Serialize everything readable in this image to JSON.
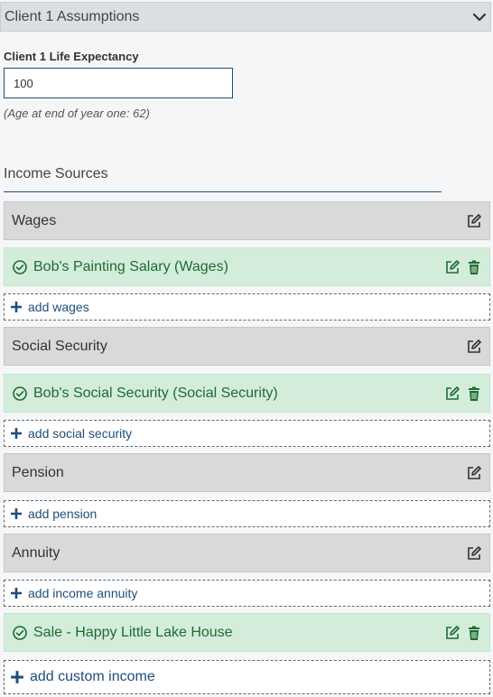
{
  "accordion": {
    "title": "Client 1 Assumptions"
  },
  "life_expectancy": {
    "label": "Client 1 Life Expectancy",
    "value": "100",
    "hint": "(Age at end of year one: 62)"
  },
  "income_sources": {
    "title": "Income Sources",
    "wages": {
      "label": "Wages",
      "items": [
        "Bob's Painting Salary (Wages)"
      ],
      "add_label": "add wages"
    },
    "social_security": {
      "label": "Social Security",
      "items": [
        "Bob's Social Security (Social Security)"
      ],
      "add_label": "add social security"
    },
    "pension": {
      "label": "Pension",
      "add_label": "add pension"
    },
    "annuity": {
      "label": "Annuity",
      "add_label": "add income annuity"
    },
    "custom": {
      "items": [
        "Sale - Happy Little Lake House"
      ],
      "add_label": "add custom income"
    }
  },
  "colors": {
    "accent": "#1f4e79",
    "item_bg": "#d4edda",
    "item_text": "#1e6b33",
    "category_bg": "#d9d9d9"
  },
  "icons": {
    "collapse": "chevron-down-icon",
    "edit": "edit-icon",
    "delete": "trash-icon",
    "done": "check-circle-icon",
    "add": "plus-icon"
  }
}
